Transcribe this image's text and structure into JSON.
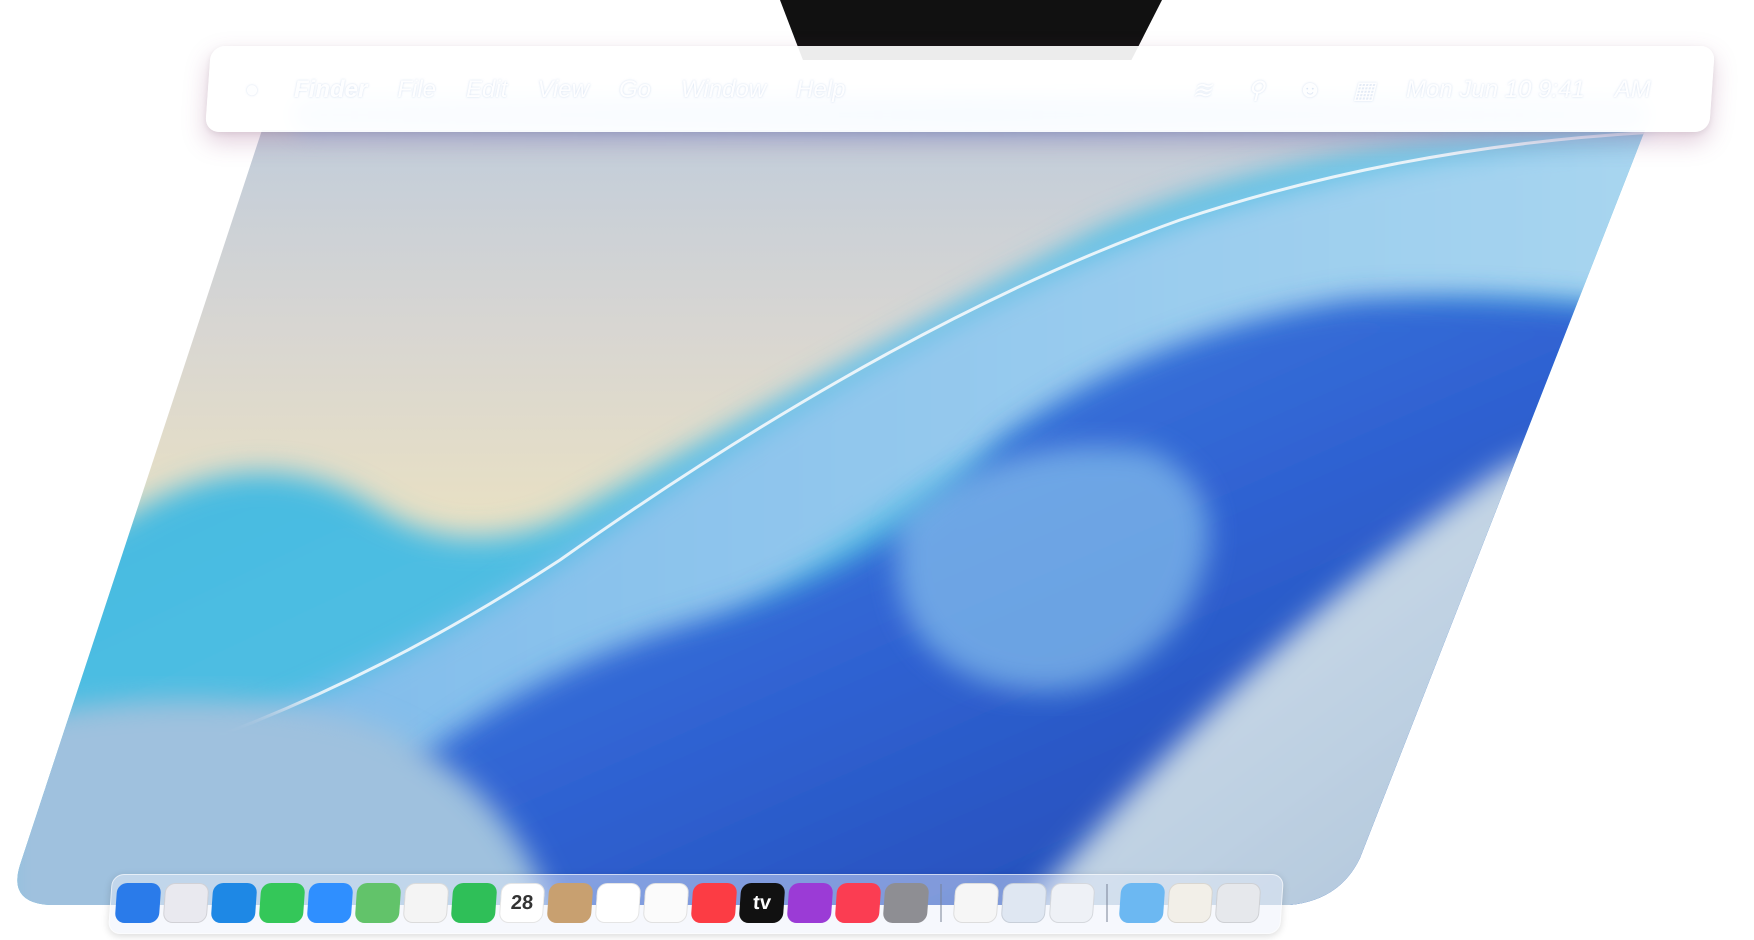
{
  "menubar": {
    "apple_icon": "apple-logo-icon",
    "app_name": "Finder",
    "menus": [
      "File",
      "Edit",
      "View",
      "Go",
      "Window",
      "Help"
    ],
    "status_icons": [
      "wifi-icon",
      "search-icon",
      "user-icon",
      "control-center-icon"
    ],
    "clock": "Mon Jun 10  9:41",
    "trailing": "AM"
  },
  "dock": {
    "apps": [
      {
        "name": "finder",
        "icon": "finder-icon",
        "color": "#2a7bea",
        "label": ""
      },
      {
        "name": "launchpad",
        "icon": "launchpad-icon",
        "color": "#e9e9ef",
        "label": ""
      },
      {
        "name": "safari",
        "icon": "safari-icon",
        "color": "#1e88e5",
        "label": ""
      },
      {
        "name": "messages",
        "icon": "messages-icon",
        "color": "#34c759",
        "label": ""
      },
      {
        "name": "mail",
        "icon": "mail-icon",
        "color": "#2f8fff",
        "label": ""
      },
      {
        "name": "maps",
        "icon": "maps-icon",
        "color": "#62c36a",
        "label": ""
      },
      {
        "name": "photos",
        "icon": "photos-icon",
        "color": "#f4f4f4",
        "label": ""
      },
      {
        "name": "facetime",
        "icon": "facetime-icon",
        "color": "#2fbf58",
        "label": ""
      },
      {
        "name": "calendar",
        "icon": "calendar-icon",
        "color": "#ffffff",
        "label": "28"
      },
      {
        "name": "contacts",
        "icon": "contacts-icon",
        "color": "#c8a070",
        "label": ""
      },
      {
        "name": "reminders",
        "icon": "reminders-icon",
        "color": "#ffffff",
        "label": ""
      },
      {
        "name": "notes",
        "icon": "notes-icon",
        "color": "#fbfbfb",
        "label": ""
      },
      {
        "name": "music",
        "icon": "music-icon",
        "color": "#fc3c44",
        "label": ""
      },
      {
        "name": "tv",
        "icon": "tv-icon",
        "color": "#111111",
        "label": "tv"
      },
      {
        "name": "podcasts",
        "icon": "podcasts-icon",
        "color": "#9b3bd6",
        "label": ""
      },
      {
        "name": "news",
        "icon": "news-icon",
        "color": "#fb3d52",
        "label": ""
      },
      {
        "name": "settings",
        "icon": "settings-icon",
        "color": "#8e8e93",
        "label": ""
      }
    ],
    "recents": [
      {
        "name": "textedit",
        "icon": "document-icon",
        "color": "#f6f6f6"
      },
      {
        "name": "preview",
        "icon": "preview-icon",
        "color": "#dfe7f2"
      },
      {
        "name": "blank-app",
        "icon": "window-icon",
        "color": "#eef1f6"
      }
    ],
    "trailing": [
      {
        "name": "downloads-folder",
        "icon": "folder-icon",
        "color": "#6cb8f2"
      },
      {
        "name": "documents-stack",
        "icon": "stack-icon",
        "color": "#f2efe8"
      },
      {
        "name": "trash",
        "icon": "trash-icon",
        "color": "#e6e8ec"
      }
    ]
  },
  "colors": {
    "sky_top": "#b3c7e0",
    "sky_mid": "#e8e0c4",
    "wave_blue": "#2f6ed8",
    "wave_light": "#8cc4ee",
    "wave_cyan": "#35b6e0"
  }
}
